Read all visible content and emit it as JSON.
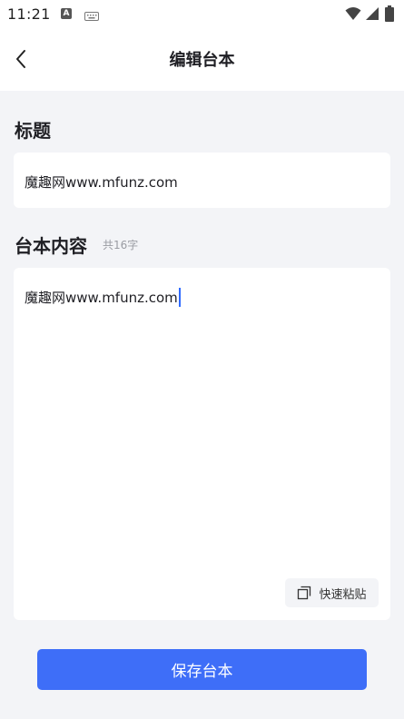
{
  "status_bar": {
    "time": "11:21",
    "a_badge": "A",
    "icons": [
      "a-notification-icon",
      "keyboard-icon",
      "wifi-icon",
      "signal-icon",
      "battery-icon"
    ]
  },
  "header": {
    "title": "编辑台本",
    "back_icon": "chevron-left-icon"
  },
  "title_section": {
    "label": "标题",
    "value": "魔趣网www.mfunz.com"
  },
  "content_section": {
    "label": "台本内容",
    "count": "共16字",
    "value": "魔趣网www.mfunz.com"
  },
  "paste_button": {
    "label": "快速粘贴",
    "icon": "copy-icon"
  },
  "save_button": {
    "label": "保存台本"
  },
  "colors": {
    "accent": "#3e6ef8",
    "cursor": "#2f6bff",
    "background": "#f3f4f7",
    "card": "#ffffff"
  }
}
